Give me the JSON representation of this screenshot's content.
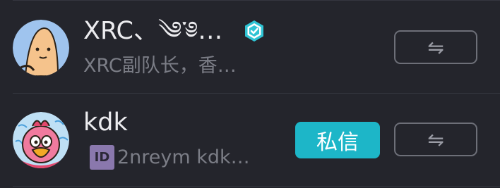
{
  "users": [
    {
      "name": "XRC、༄་༅…",
      "subtitle": "XRC副队长，香…",
      "verified": true,
      "action_icon": "swap-arrows-icon",
      "action_symbol": "⇋"
    },
    {
      "name": "kdk",
      "id_badge": "ID",
      "subtitle": "2nreym  kdk…",
      "message_button": "私信",
      "action_icon": "swap-arrows-icon",
      "action_symbol": "⇋"
    }
  ],
  "colors": {
    "background": "#24252c",
    "accent": "#1db6c8",
    "verified": "#2fc4d4",
    "secondary_text": "#7b7d86"
  }
}
